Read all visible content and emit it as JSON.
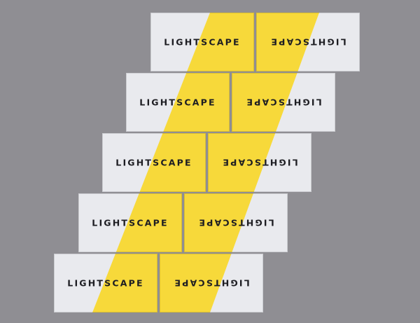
{
  "scene": {
    "background_color": "#8f8e93",
    "card_color": "#e9eaee",
    "stripe_color": "#f7d93a",
    "text_color": "#1d1d22"
  },
  "cards": [
    {
      "left_text": "LIGHTSCAPE",
      "right_text": "LIGHTSCAPE"
    },
    {
      "left_text": "LIGHTSCAPE",
      "right_text": "LIGHTSCAPE"
    },
    {
      "left_text": "LIGHTSCAPE",
      "right_text": "LIGHTSCAPE"
    },
    {
      "left_text": "LIGHTSCAPE",
      "right_text": "LIGHTSCAPE"
    },
    {
      "left_text": "LIGHTSCAPE",
      "right_text": "LIGHTSCAPE"
    }
  ]
}
